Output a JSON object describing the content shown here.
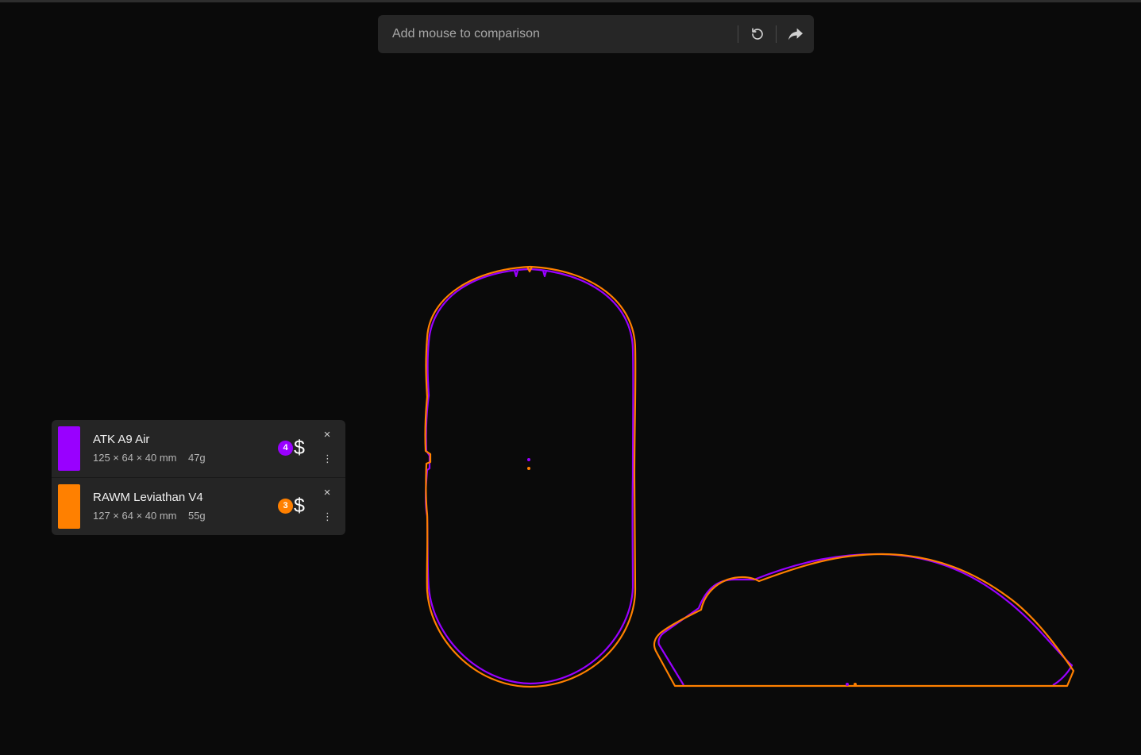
{
  "search": {
    "placeholder": "Add mouse to comparison",
    "reset_icon": "rotate-ccw-icon",
    "share_icon": "share-arrow-icon"
  },
  "mice": [
    {
      "name": "ATK A9 Air",
      "specs": "125 × 64 × 40 mm    47g",
      "price_tier": "4",
      "price_symbol": "$",
      "color": "#9900ff",
      "close_label": "×",
      "more_label": "⋮"
    },
    {
      "name": "RAWM Leviathan V4",
      "specs": "127 × 64 × 40 mm    55g",
      "price_tier": "3",
      "price_symbol": "$",
      "color": "#ff8000",
      "close_label": "×",
      "more_label": "⋮"
    }
  ],
  "colors": {
    "background": "#0a0a0a",
    "panel": "#252525",
    "mouse_a": "#9900ff",
    "mouse_b": "#ff8000"
  }
}
